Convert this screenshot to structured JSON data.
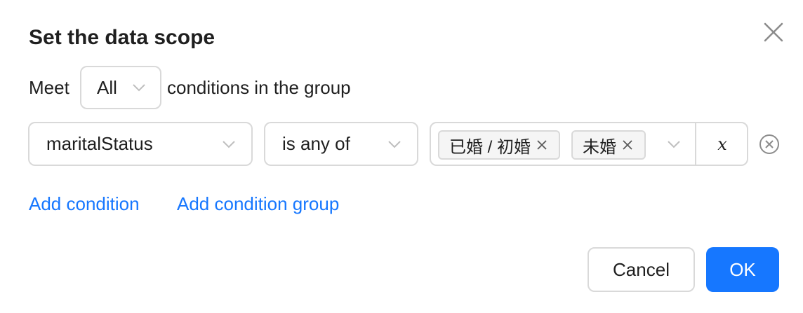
{
  "dialog": {
    "title": "Set the data scope",
    "close_icon": "close-icon"
  },
  "group_row": {
    "prefix": "Meet",
    "match_value": "All",
    "suffix": "conditions in the group"
  },
  "condition": {
    "field_value": "maritalStatus",
    "operator_value": "is any of",
    "selected_tags": [
      "已婚 / 初婚",
      "未婚"
    ],
    "variable_label": "x",
    "remove_icon": "circle-close-icon"
  },
  "links": {
    "add_condition": "Add condition",
    "add_condition_group": "Add condition group"
  },
  "footer": {
    "cancel_label": "Cancel",
    "ok_label": "OK"
  },
  "colors": {
    "primary": "#1677ff",
    "border": "#d9d9d9",
    "tag_bg": "#f5f5f5",
    "text": "#1f1f1f"
  }
}
